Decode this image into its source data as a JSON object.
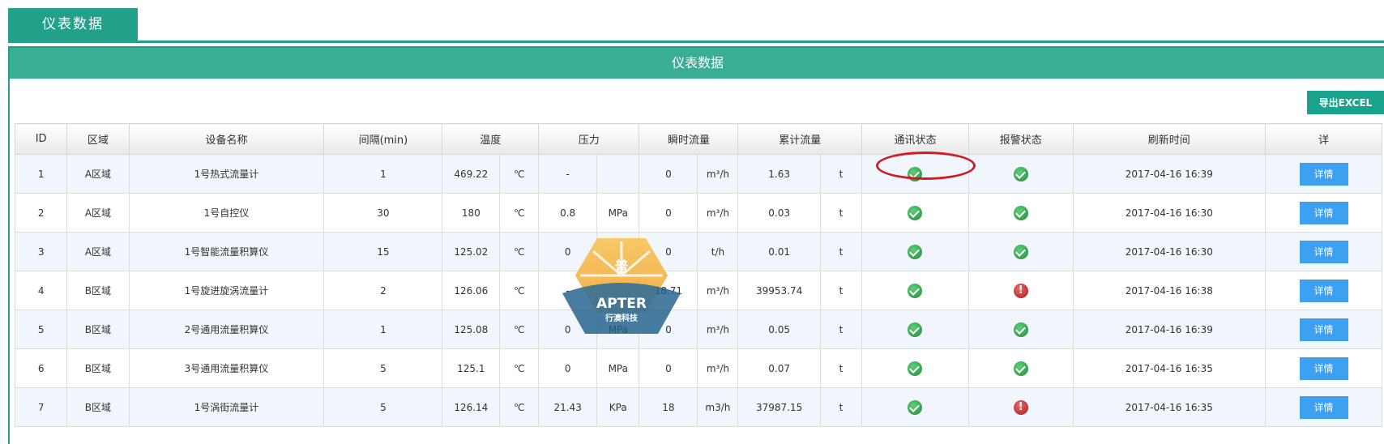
{
  "tab": {
    "label": "仪表数据"
  },
  "panel": {
    "title": "仪表数据",
    "export_label": "导出EXCEL"
  },
  "columns": [
    "ID",
    "区域",
    "设备名称",
    "间隔(min)",
    "温度",
    "压力",
    "瞬时流量",
    "累计流量",
    "通讯状态",
    "报警状态",
    "刷新时间",
    "详"
  ],
  "rows": [
    {
      "id": "1",
      "area": "A区域",
      "name": "1号热式流量计",
      "interval": "1",
      "temp": "469.22",
      "temp_unit": "℃",
      "pressure": "-",
      "pressure_unit": "",
      "flow": "0",
      "flow_unit": "m³/h",
      "total": "1.63",
      "total_unit": "t",
      "comm": "ok",
      "alarm": "ok",
      "time": "2017-04-16 16:39",
      "detail": "详情"
    },
    {
      "id": "2",
      "area": "A区域",
      "name": "1号自控仪",
      "interval": "30",
      "temp": "180",
      "temp_unit": "℃",
      "pressure": "0.8",
      "pressure_unit": "MPa",
      "flow": "0",
      "flow_unit": "m³/h",
      "total": "0.03",
      "total_unit": "t",
      "comm": "ok",
      "alarm": "ok",
      "time": "2017-04-16 16:30",
      "detail": "详情"
    },
    {
      "id": "3",
      "area": "A区域",
      "name": "1号智能流量积算仪",
      "interval": "15",
      "temp": "125.02",
      "temp_unit": "℃",
      "pressure": "0",
      "pressure_unit": "",
      "flow": "0",
      "flow_unit": "t/h",
      "total": "0.01",
      "total_unit": "t",
      "comm": "ok",
      "alarm": "ok",
      "time": "2017-04-16 16:30",
      "detail": "详情"
    },
    {
      "id": "4",
      "area": "B区域",
      "name": "1号旋进旋涡流量计",
      "interval": "2",
      "temp": "126.06",
      "temp_unit": "℃",
      "pressure": "-",
      "pressure_unit": "",
      "flow": "18.71",
      "flow_unit": "m³/h",
      "total": "39953.74",
      "total_unit": "t",
      "comm": "ok",
      "alarm": "alarm",
      "time": "2017-04-16 16:38",
      "detail": "详情"
    },
    {
      "id": "5",
      "area": "B区域",
      "name": "2号通用流量积算仪",
      "interval": "1",
      "temp": "125.08",
      "temp_unit": "℃",
      "pressure": "0",
      "pressure_unit": "MPa",
      "flow": "0",
      "flow_unit": "m³/h",
      "total": "0.05",
      "total_unit": "t",
      "comm": "ok",
      "alarm": "ok",
      "time": "2017-04-16 16:39",
      "detail": "详情"
    },
    {
      "id": "6",
      "area": "B区域",
      "name": "3号通用流量积算仪",
      "interval": "5",
      "temp": "125.1",
      "temp_unit": "℃",
      "pressure": "0",
      "pressure_unit": "MPa",
      "flow": "0",
      "flow_unit": "m³/h",
      "total": "0.07",
      "total_unit": "t",
      "comm": "ok",
      "alarm": "ok",
      "time": "2017-04-16 16:35",
      "detail": "详情"
    },
    {
      "id": "7",
      "area": "B区域",
      "name": "1号涡街流量计",
      "interval": "5",
      "temp": "126.14",
      "temp_unit": "℃",
      "pressure": "21.43",
      "pressure_unit": "KPa",
      "flow": "18",
      "flow_unit": "m3/h",
      "total": "37987.15",
      "total_unit": "t",
      "comm": "ok",
      "alarm": "alarm",
      "time": "2017-04-16 16:35",
      "detail": "详情"
    }
  ],
  "watermark": {
    "text_top": "普",
    "brand": "APTER",
    "subtitle": "行澳科技"
  },
  "colors": {
    "accent": "#23a08a",
    "header_band": "#3aad95",
    "detail_button": "#3da0f0",
    "alarm": "#c0282a",
    "ok": "#2e9e4a",
    "annotation": "#d01c24"
  }
}
